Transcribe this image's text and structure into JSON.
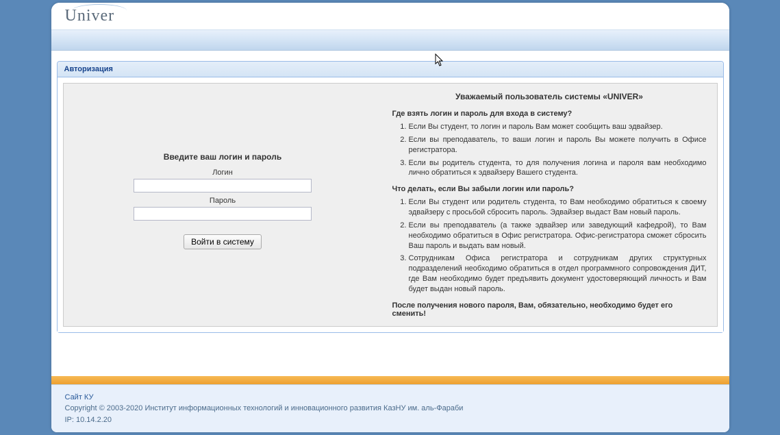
{
  "logo": "Univer",
  "panel_title": "Авторизация",
  "login_form": {
    "title": "Введите ваш логин и пароль",
    "login_label": "Логин",
    "password_label": "Пароль",
    "submit_label": "Войти в систему"
  },
  "info": {
    "heading": "Уважаемый пользователь системы «UNIVER»",
    "q1": "Где взять логин и пароль для входа в систему?",
    "q1_items": [
      "Если Вы студент, то логин и пароль Вам может сообщить ваш эдвайзер.",
      "Если вы преподаватель, то ваши логин и пароль Вы можете получить в Офисе регистратора.",
      "Если вы родитель студента, то для получения логина и пароля вам необходимо лично обратиться к эдвайзеру Вашего студента."
    ],
    "q2": "Что делать, если Вы забыли логин или пароль?",
    "q2_items": [
      "Если Вы студент или родитель студента, то Вам необходимо обратиться к своему эдвайзеру с просьбой сбросить пароль. Эдвайзер выдаст Вам новый пароль.",
      "Если вы преподаватель (а также эдвайзер или заведующий кафедрой), то Вам необходимо обратиться в Офис регистратора. Офис-регистратора сможет сбросить Ваш пароль и выдать вам новый.",
      "Сотрудникам Офиса регистратора и сотрудникам других структурных подразделений необходимо обратиться в отдел программного сопровождения ДИТ, где Вам необходимо будет предъявить документ удостоверяющий личность и Вам будет выдан новый пароль."
    ],
    "final_note": "После получения нового пароля, Вам, обязательно, необходимо будет его сменить!"
  },
  "footer": {
    "site_link": "Сайт КУ",
    "copyright": "Copyright © 2003-2020 Институт информационных технологий и инновационного развития КазНУ им. аль-Фараби",
    "ip": "IP: 10.14.2.20"
  }
}
